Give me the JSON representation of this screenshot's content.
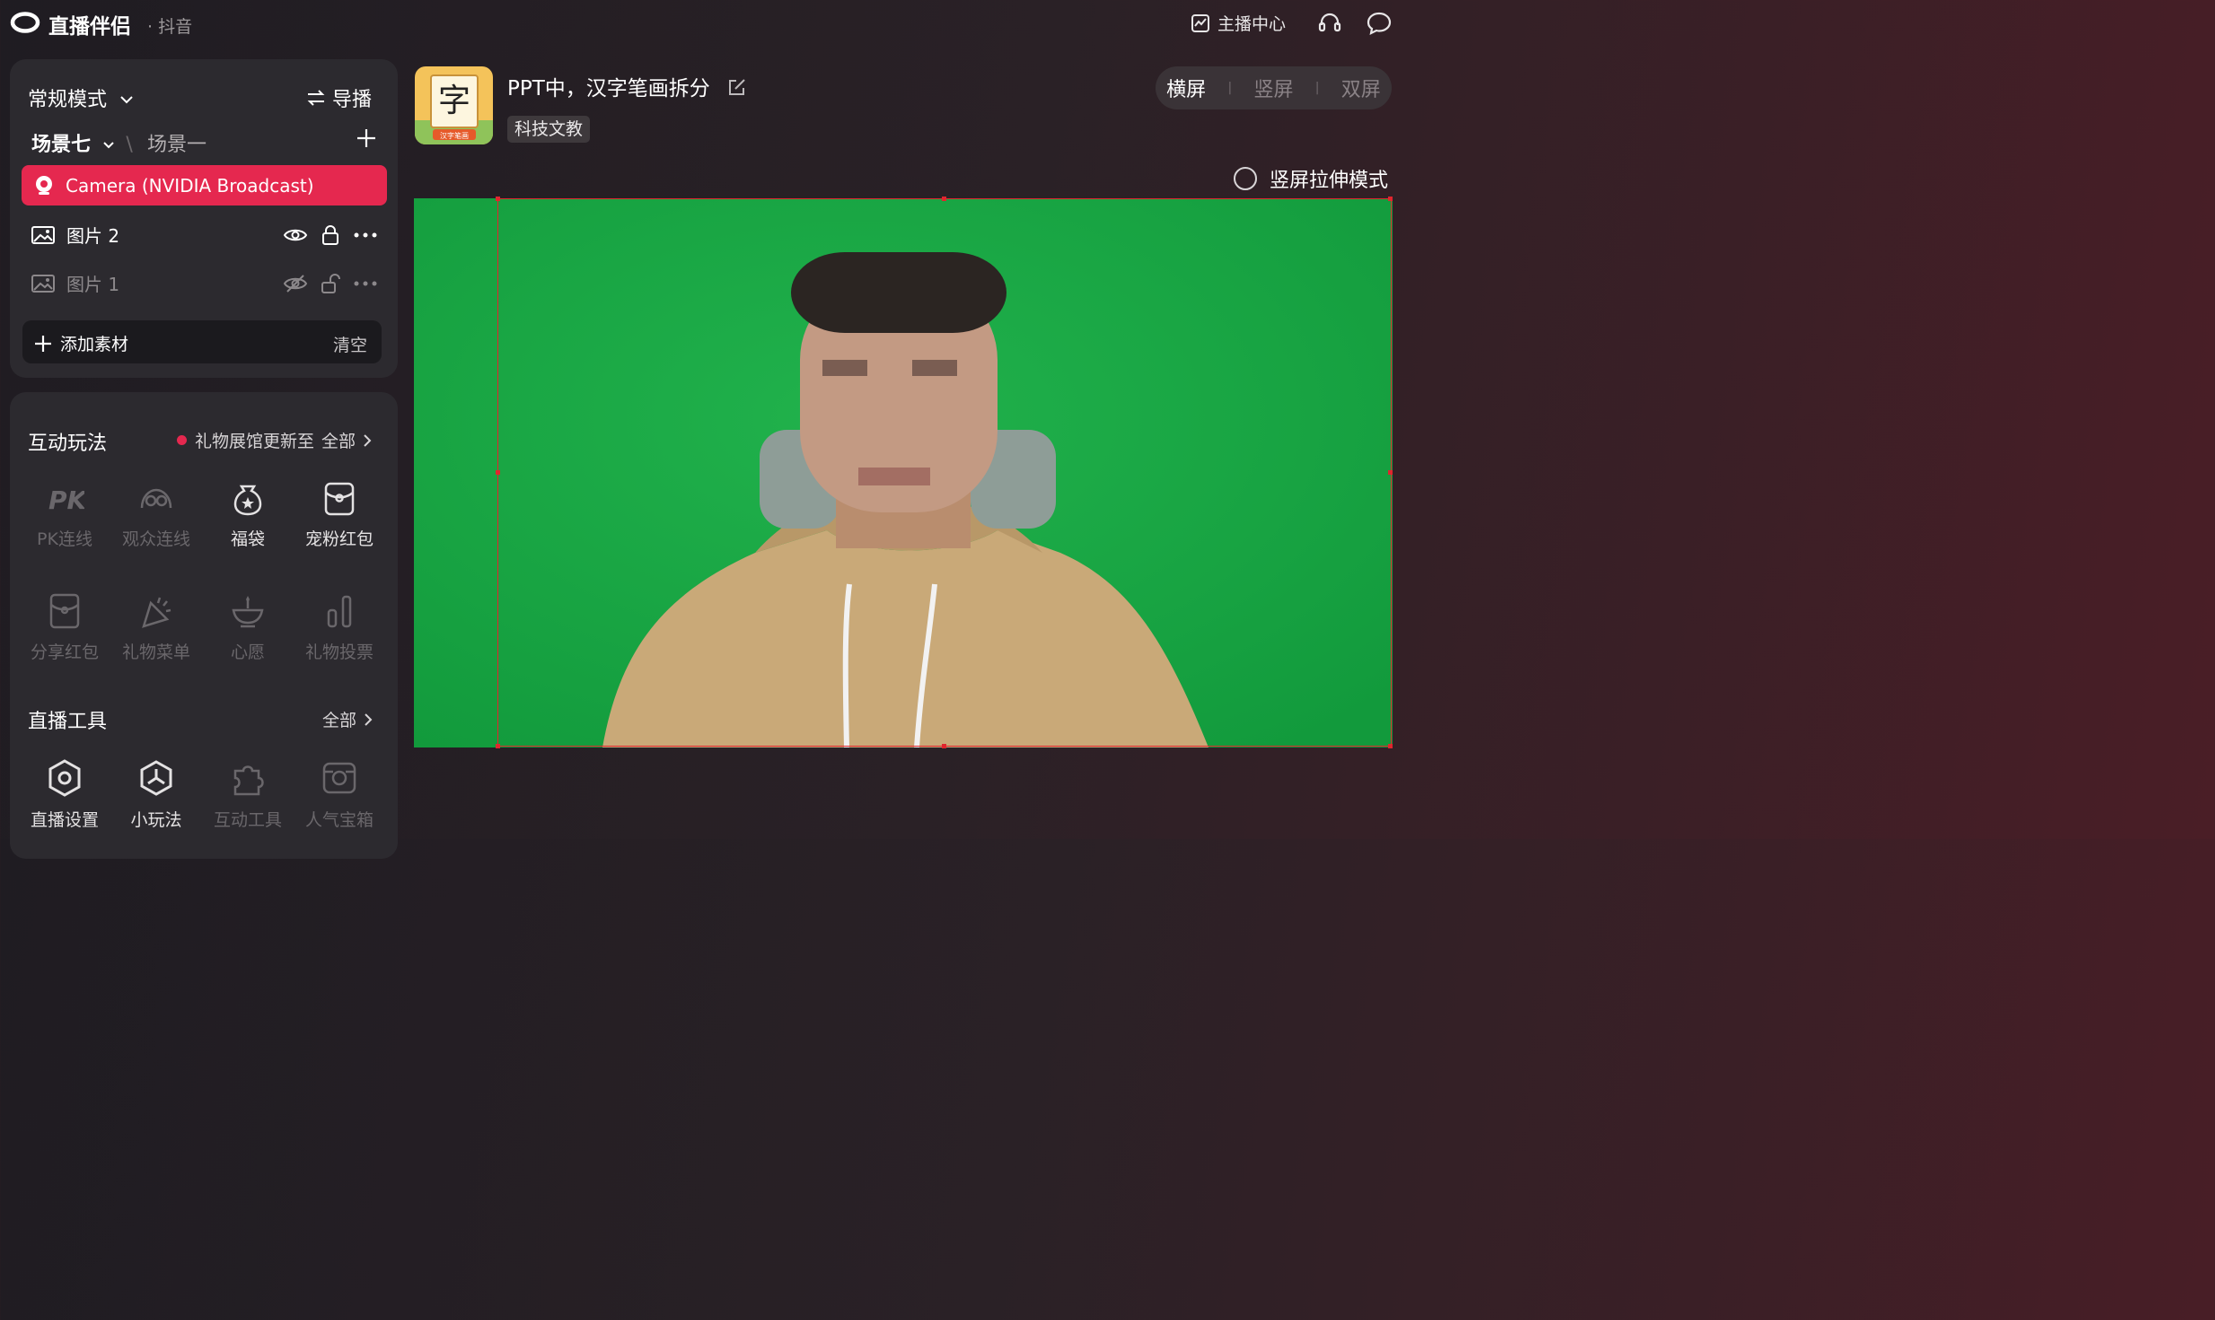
{
  "app": {
    "title": "直播伴侣",
    "platform": "· 抖音"
  },
  "topbar": {
    "host_center": "主播中心"
  },
  "scene_panel": {
    "mode": "常规模式",
    "director": "导播",
    "scenes": [
      "场景七",
      "场景一"
    ],
    "sources": [
      {
        "label": "Camera (NVIDIA Broadcast)",
        "active": true
      },
      {
        "label": "图片 2",
        "active": false
      },
      {
        "label": "图片 1",
        "active": false
      }
    ],
    "add_label": "添加素材",
    "clear_label": "清空"
  },
  "interactive": {
    "title": "互动玩法",
    "notice": "礼物展馆更新至",
    "all_label": "全部",
    "items": [
      {
        "label": "PK连线",
        "icon": "pk-icon",
        "enabled": false
      },
      {
        "label": "观众连线",
        "icon": "audience-link-icon",
        "enabled": false
      },
      {
        "label": "福袋",
        "icon": "lucky-bag-icon",
        "enabled": true
      },
      {
        "label": "宠粉红包",
        "icon": "fan-red-packet-icon",
        "enabled": true
      },
      {
        "label": "分享红包",
        "icon": "share-red-packet-icon",
        "enabled": false
      },
      {
        "label": "礼物菜单",
        "icon": "gift-menu-icon",
        "enabled": false
      },
      {
        "label": "心愿",
        "icon": "wish-icon",
        "enabled": false
      },
      {
        "label": "礼物投票",
        "icon": "gift-vote-icon",
        "enabled": false
      }
    ]
  },
  "tools": {
    "title": "直播工具",
    "all_label": "全部",
    "items": [
      {
        "label": "直播设置",
        "icon": "live-settings-icon",
        "enabled": true
      },
      {
        "label": "小玩法",
        "icon": "mini-game-icon",
        "enabled": true
      },
      {
        "label": "互动工具",
        "icon": "interactive-tools-icon",
        "enabled": false
      },
      {
        "label": "人气宝箱",
        "icon": "popularity-chest-icon",
        "enabled": false
      }
    ]
  },
  "live": {
    "thumbnail_char": "字",
    "thumbnail_caption": "汉字笔画",
    "title": "PPT中，汉字笔画拆分",
    "category": "科技文教"
  },
  "orientation": {
    "options": [
      "横屏",
      "竖屏",
      "双屏"
    ],
    "selected": "横屏"
  },
  "stretch_mode": {
    "label": "竖屏拉伸模式",
    "checked": false
  },
  "colors": {
    "accent": "#e5284f",
    "canvas_bg": "#1aa745",
    "selection": "#e0262e"
  }
}
